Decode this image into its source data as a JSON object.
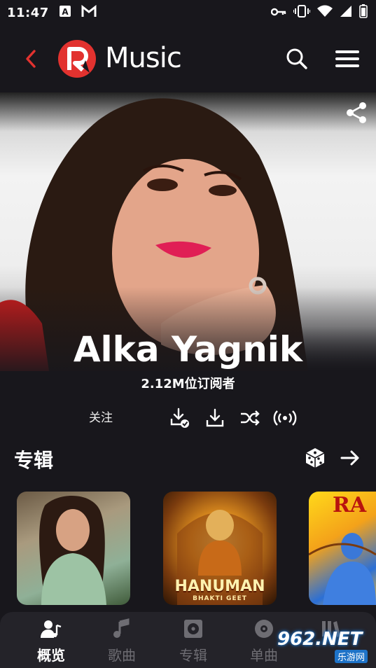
{
  "status_bar": {
    "time": "11:47",
    "left_icons": [
      "a-box-icon",
      "gmail-m-icon"
    ],
    "right_icons": [
      "key-icon",
      "vibrate-icon",
      "wifi-icon",
      "signal-icon",
      "battery-icon"
    ]
  },
  "app_bar": {
    "brand_text": "Music",
    "accent_color": "#e2322f",
    "back_icon": "chevron-left-icon",
    "logo_icon": "r-logo-icon",
    "search_icon": "search-icon",
    "menu_icon": "hamburger-icon"
  },
  "hero": {
    "share_icon": "share-icon",
    "artist_name": "Alka Yagnik",
    "subscribers": "2.12M位订阅者"
  },
  "actions": {
    "follow_label": "关注",
    "icons": [
      "downloaded-check-icon",
      "download-icon",
      "shuffle-icon",
      "radio-broadcast-icon"
    ]
  },
  "albums_section": {
    "title": "专辑",
    "dice_icon": "dice-icon",
    "more_icon": "arrow-right-icon",
    "cards": [
      {
        "title_text": ""
      },
      {
        "title_text": "HANUMAN",
        "subtitle_text": "BHAKTI GEET"
      },
      {
        "title_text": "RA"
      }
    ]
  },
  "bottom_nav": {
    "items": [
      {
        "label": "概览",
        "icon": "person-music-icon",
        "active": true
      },
      {
        "label": "歌曲",
        "icon": "music-note-icon",
        "active": false
      },
      {
        "label": "专辑",
        "icon": "album-icon",
        "active": false
      },
      {
        "label": "单曲",
        "icon": "disc-icon",
        "active": false
      },
      {
        "label": "",
        "icon": "library-icon",
        "active": false
      }
    ]
  },
  "watermark": {
    "main": "962.NET",
    "sub": "乐游网"
  }
}
